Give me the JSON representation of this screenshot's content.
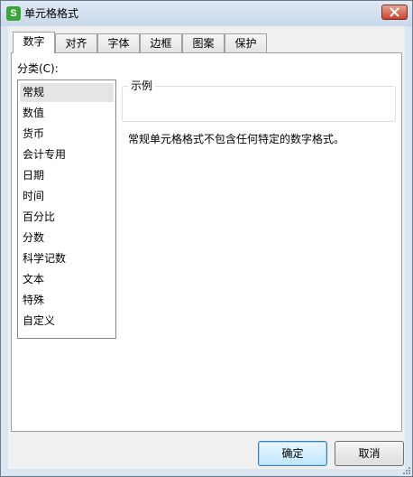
{
  "window": {
    "title": "单元格格式",
    "app_icon_letter": "S"
  },
  "tabs": [
    {
      "label": "数字",
      "active": true
    },
    {
      "label": "对齐",
      "active": false
    },
    {
      "label": "字体",
      "active": false
    },
    {
      "label": "边框",
      "active": false
    },
    {
      "label": "图案",
      "active": false
    },
    {
      "label": "保护",
      "active": false
    }
  ],
  "number_tab": {
    "category_label": "分类(C):",
    "categories": [
      "常规",
      "数值",
      "货币",
      "会计专用",
      "日期",
      "时间",
      "百分比",
      "分数",
      "科学记数",
      "文本",
      "特殊",
      "自定义"
    ],
    "selected_category": "常规",
    "example_label": "示例",
    "example_value": "",
    "description": "常规单元格格式不包含任何特定的数字格式。"
  },
  "buttons": {
    "ok_label": "确定",
    "cancel_label": "取消"
  },
  "colors": {
    "title_bar": "#c9d8ea",
    "close_button": "#c8432c",
    "app_icon": "#3aa53a",
    "selected_item": "#e5e5e5",
    "default_button": "#bee6fd"
  }
}
